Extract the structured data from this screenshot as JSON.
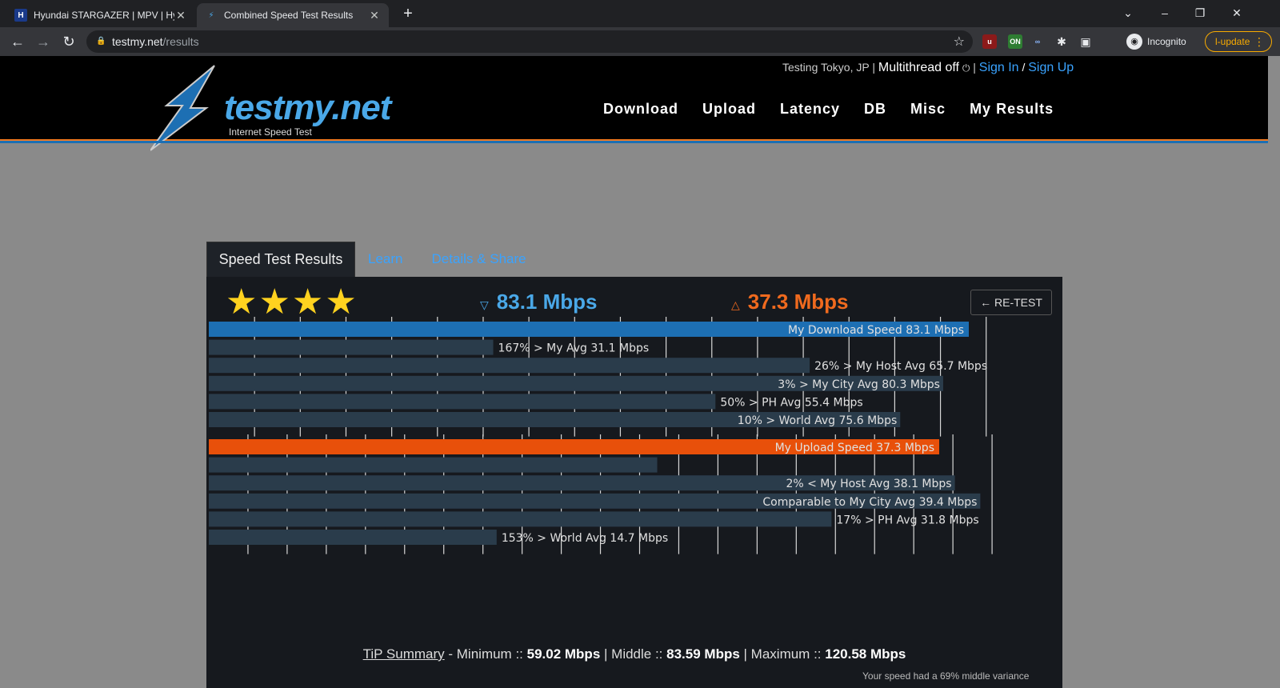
{
  "browser": {
    "tabs": [
      {
        "title": "Hyundai STARGAZER | MPV | Hyu",
        "favicon": "H",
        "active": false
      },
      {
        "title": "Combined Speed Test Results",
        "favicon": "⚡",
        "active": true
      }
    ],
    "url_host": "testmy.net",
    "url_path": "/results",
    "profile_label": "Incognito",
    "update_label": "l-update"
  },
  "site": {
    "status_location": "Testing Tokyo, JP",
    "multithread": "Multithread off",
    "sign_in": "Sign In",
    "sign_up": "Sign Up",
    "logo_text": "testmy.net",
    "logo_sub": "Internet Speed Test",
    "nav": [
      "Download",
      "Upload",
      "Latency",
      "DB",
      "Misc",
      "My Results"
    ]
  },
  "content_tabs": {
    "active": "Speed Test Results",
    "links": [
      "Learn",
      "Details & Share"
    ]
  },
  "results": {
    "stars": "★★★★",
    "rating": 4,
    "download": "83.1 Mbps",
    "upload": "37.3 Mbps",
    "retest_label": "← RE-TEST",
    "colors": {
      "download": "#1d6fb3",
      "upload": "#e8500a",
      "compare": "#2a3c4b"
    }
  },
  "chart_data": {
    "type": "bar",
    "orientation": "horizontal",
    "groups": [
      {
        "name": "Download",
        "bars": [
          {
            "label": "My Download Speed 83.1 Mbps",
            "value": 83.1,
            "primary": true
          },
          {
            "label": "167% > My Avg 31.1 Mbps",
            "value": 31.1
          },
          {
            "label": "26% > My Host Avg 65.7 Mbps",
            "value": 65.7
          },
          {
            "label": "3% > My City Avg 80.3 Mbps",
            "value": 80.3
          },
          {
            "label": "50% > PH Avg 55.4 Mbps",
            "value": 55.4
          },
          {
            "label": "10% > World Avg 75.6 Mbps",
            "value": 75.6
          }
        ]
      },
      {
        "name": "Upload",
        "bars": [
          {
            "label": "My Upload Speed 37.3 Mbps",
            "value": 37.3,
            "primary": true
          },
          {
            "label": "",
            "value": 22.9
          },
          {
            "label": "2% < My Host Avg 38.1 Mbps",
            "value": 38.1
          },
          {
            "label": "Comparable to My City Avg 39.4 Mbps",
            "value": 39.4
          },
          {
            "label": "17% > PH Avg 31.8 Mbps",
            "value": 31.8
          },
          {
            "label": "153% > World Avg 14.7 Mbps",
            "value": 14.7
          }
        ]
      }
    ]
  },
  "tip": {
    "link": "TiP Summary",
    "prefix": "- Minimum ::",
    "min": "59.02 Mbps",
    "mid_label": "| Middle ::",
    "mid": "83.59 Mbps",
    "max_label": "| Maximum ::",
    "max": "120.58 Mbps",
    "variance": "Your speed had a 69% middle variance"
  }
}
